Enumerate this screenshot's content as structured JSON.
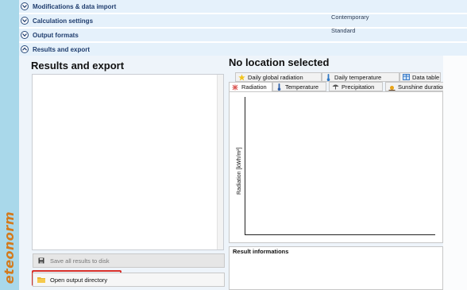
{
  "brand": {
    "text": "eteonorm",
    "color": "#d37a1c",
    "strip_color": "#a9d8ea"
  },
  "accordion": [
    {
      "label": "Modifications & data import",
      "value": "",
      "icon": "chevron-down-icon"
    },
    {
      "label": "Calculation settings",
      "value": "Contemporary",
      "icon": "chevron-down-icon"
    },
    {
      "label": "Output formats",
      "value": "Standard",
      "icon": "chevron-down-icon"
    },
    {
      "label": "Results and export",
      "value": "",
      "icon": "chevron-up-icon"
    }
  ],
  "results": {
    "title": "Results and export",
    "save_label": "Save all results to disk",
    "save_icon": "disk-icon",
    "open_label": "Open output directory",
    "open_icon": "folder-icon",
    "highlight_color": "#d8302a"
  },
  "location": {
    "title": "No location selected",
    "tabs_row1": [
      {
        "label": "Daily global radiation",
        "icon": "star-icon"
      },
      {
        "label": "Daily temperature",
        "icon": "thermometer-icon"
      },
      {
        "label": "Data table",
        "icon": "table-icon"
      }
    ],
    "tabs_row2": [
      {
        "label": "Radiation",
        "icon": "radiation-icon",
        "active": true
      },
      {
        "label": "Temperature",
        "icon": "thermometer-icon"
      },
      {
        "label": "Precipitation",
        "icon": "umbrella-icon"
      },
      {
        "label": "Sunshine duration",
        "icon": "sun-icon"
      }
    ],
    "y_axis_label": "Radiation [kWh/m²]",
    "result_info_label": "Result informations"
  }
}
